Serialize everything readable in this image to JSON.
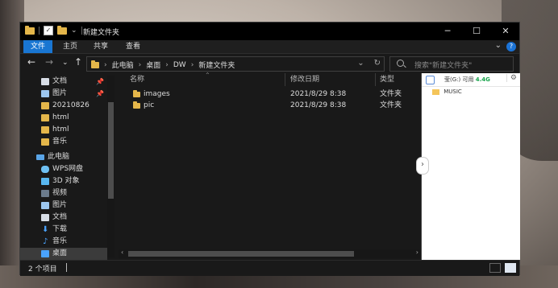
{
  "window": {
    "title": "新建文件夹",
    "controls": {
      "minimize": "─",
      "maximize": "☐",
      "close": "✕"
    },
    "ribbon_tabs": [
      {
        "label": "文件",
        "active": true
      },
      {
        "label": "主页",
        "active": false
      },
      {
        "label": "共享",
        "active": false
      },
      {
        "label": "查看",
        "active": false
      }
    ],
    "help_label": "?"
  },
  "navigation": {
    "back": "←",
    "forward": "→",
    "recent": "⌄",
    "up": "↑",
    "breadcrumbs": [
      "此电脑",
      "桌面",
      "DW",
      "新建文件夹"
    ],
    "search_placeholder": "搜索\"新建文件夹\""
  },
  "sidebar": {
    "quick_access": [
      {
        "label": "文档",
        "icon": "documents-icon",
        "pinned": true
      },
      {
        "label": "图片",
        "icon": "pictures-icon",
        "pinned": true
      },
      {
        "label": "20210826",
        "icon": "folder-icon",
        "pinned": false
      },
      {
        "label": "html",
        "icon": "folder-icon",
        "pinned": false
      },
      {
        "label": "html",
        "icon": "folder-icon",
        "pinned": false
      },
      {
        "label": "音乐",
        "icon": "folder-icon",
        "pinned": false
      }
    ],
    "this_pc": {
      "label": "此电脑",
      "items": [
        {
          "label": "WPS网盘",
          "icon": "cloud-icon"
        },
        {
          "label": "3D 对象",
          "icon": "3d-objects-icon"
        },
        {
          "label": "视频",
          "icon": "video-icon"
        },
        {
          "label": "图片",
          "icon": "pictures-icon"
        },
        {
          "label": "文档",
          "icon": "documents-icon"
        },
        {
          "label": "下载",
          "icon": "download-icon"
        },
        {
          "label": "音乐",
          "icon": "music-icon"
        },
        {
          "label": "桌面",
          "icon": "desktop-icon",
          "selected": true
        }
      ]
    }
  },
  "file_list": {
    "columns": [
      "名称",
      "修改日期",
      "类型"
    ],
    "rows": [
      {
        "name": "images",
        "modified": "2021/8/29 8:38",
        "type": "文件夹"
      },
      {
        "name": "pic",
        "modified": "2021/8/29 8:38",
        "type": "文件夹"
      }
    ]
  },
  "preview": {
    "drive_label": "莹(G:)",
    "free_label": "可用",
    "free_value": "4.4G",
    "files": [
      {
        "name": "MUSIC"
      }
    ],
    "expand_glyph": "›"
  },
  "status_bar": {
    "count_text": "2 个项目"
  },
  "colors": {
    "accent": "#1976d2",
    "folder": "#e4b64a",
    "window_bg": "#191919"
  }
}
